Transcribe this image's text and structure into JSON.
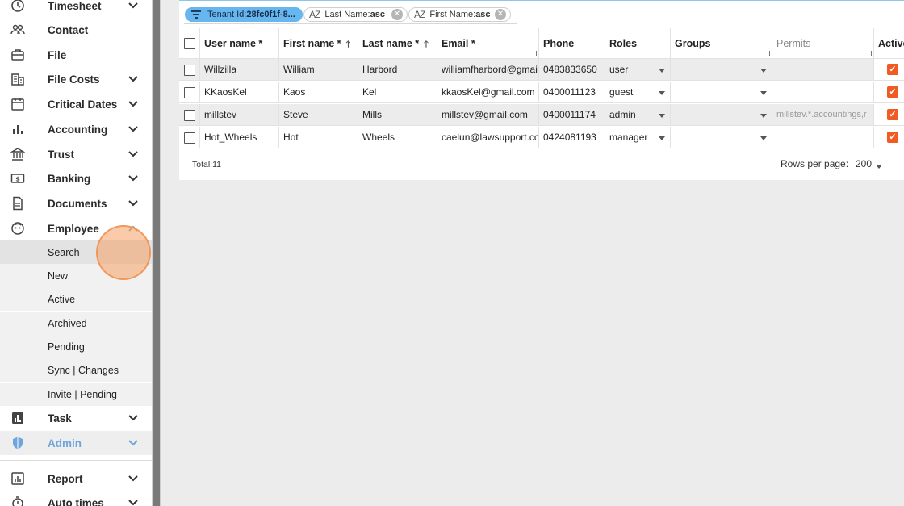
{
  "sidebar": {
    "items": [
      {
        "label": "Timesheet",
        "icon": "clock-icon"
      },
      {
        "label": "Contact",
        "icon": "people-icon"
      },
      {
        "label": "File",
        "icon": "briefcase-icon"
      },
      {
        "label": "File Costs",
        "icon": "building-icon"
      },
      {
        "label": "Critical Dates",
        "icon": "calendar-icon"
      },
      {
        "label": "Accounting",
        "icon": "bar-chart-icon"
      },
      {
        "label": "Trust",
        "icon": "bank-icon"
      },
      {
        "label": "Banking",
        "icon": "dollar-bill-icon"
      },
      {
        "label": "Documents",
        "icon": "document-icon"
      },
      {
        "label": "Employee",
        "icon": "face-icon"
      }
    ],
    "employee_sub": [
      "Search",
      "New",
      "Active",
      "Archived",
      "Pending",
      "Sync | Changes",
      "Invite | Pending"
    ],
    "bottom_items": [
      {
        "label": "Task",
        "icon": "task-chart-icon"
      },
      {
        "label": "Admin",
        "icon": "shield-icon"
      },
      {
        "label": "Report",
        "icon": "report-icon"
      },
      {
        "label": "Auto times",
        "icon": "stopwatch-icon"
      }
    ]
  },
  "filters": {
    "tenant_prefix": "Tenant Id:",
    "tenant_value": "28fc0f1f-8...",
    "last_name_prefix": "Last Name:",
    "last_name_value": "asc",
    "first_name_prefix": "First Name:",
    "first_name_value": "asc",
    "az_glyph": "A͞Z"
  },
  "table": {
    "headers": {
      "username": "User name *",
      "firstname": "First name *",
      "lastname": "Last name *",
      "email": "Email *",
      "phone": "Phone",
      "roles": "Roles",
      "groups": "Groups",
      "permits": "Permits",
      "active": "Active"
    },
    "rows": [
      {
        "username": "Willzilla",
        "firstname": "William",
        "lastname": "Harbord",
        "email": "williamfharbord@gmail",
        "phone": "0483833650",
        "role": "user",
        "group": "",
        "permits": "",
        "active": true
      },
      {
        "username": "KKaosKel",
        "firstname": "Kaos",
        "lastname": "Kel",
        "email": "kkaosKel@gmail.com",
        "phone": "0400011123",
        "role": "guest",
        "group": "",
        "permits": "",
        "active": true
      },
      {
        "username": "millstev",
        "firstname": "Steve",
        "lastname": "Mills",
        "email": "millstev@gmail.com",
        "phone": "0400011174",
        "role": "admin",
        "group": "",
        "permits": "millstev.*.accountings,r",
        "active": true
      },
      {
        "username": "Hot_Wheels",
        "firstname": "Hot",
        "lastname": "Wheels",
        "email": "caelun@lawsupport.cor",
        "phone": "0424081193",
        "role": "manager",
        "group": "",
        "permits": "",
        "active": true
      }
    ]
  },
  "footer": {
    "total": "Total:11",
    "rows_per_page_label": "Rows per page:",
    "rows_per_page_value": "200"
  },
  "colors": {
    "accent_orange": "#f15a22",
    "chip_blue": "#66b6f0",
    "admin_blue": "#6ea5dc"
  }
}
